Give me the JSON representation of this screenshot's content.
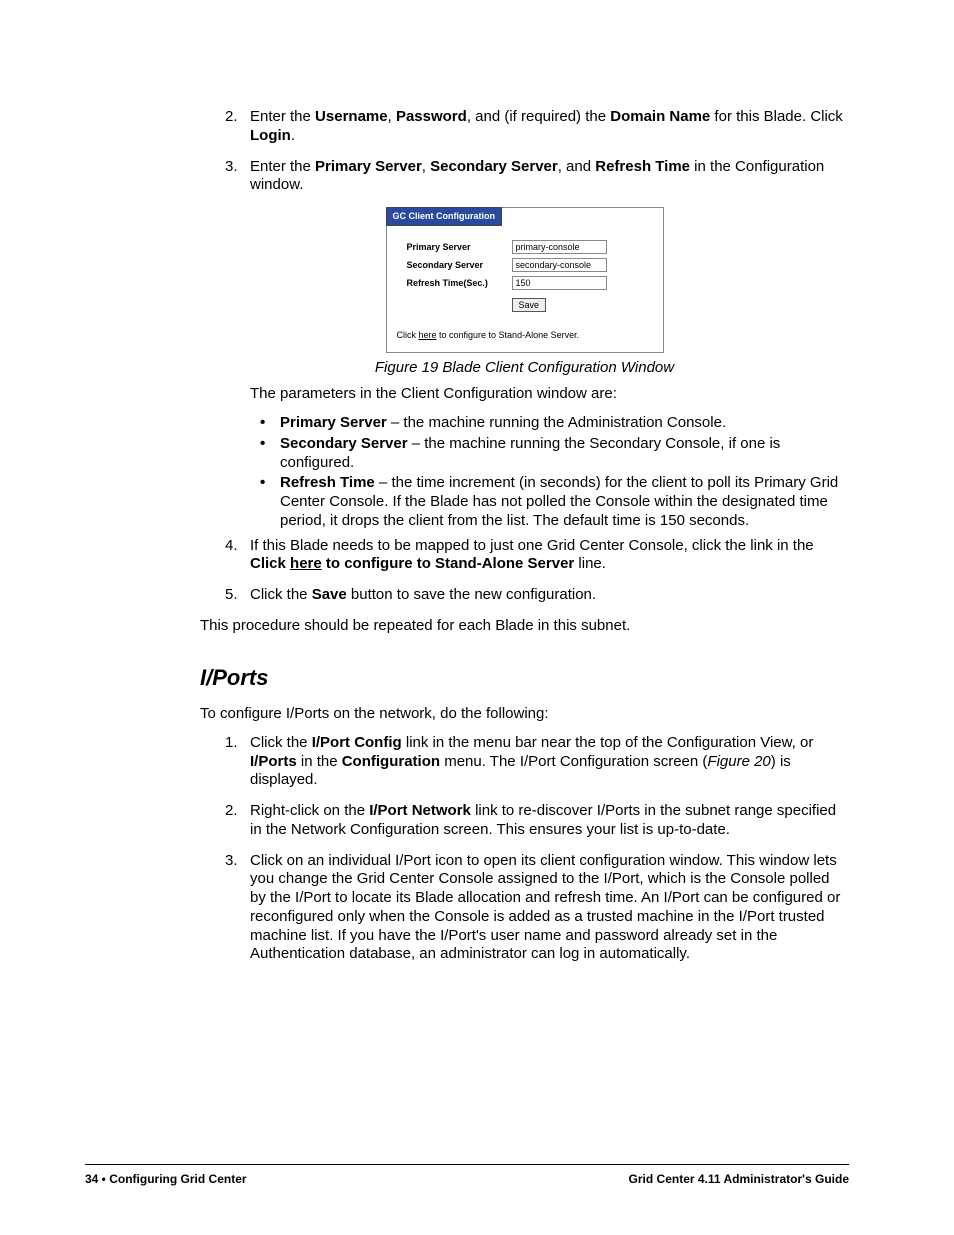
{
  "step2": {
    "num": "2.",
    "t1": "Enter the ",
    "b1": "Username",
    "t2": ", ",
    "b2": "Password",
    "t3": ", and (if required) the ",
    "b3": "Domain Name",
    "t4": " for this Blade. Click ",
    "b4": "Login",
    "t5": "."
  },
  "step3": {
    "num": "3.",
    "t1": "Enter the ",
    "b1": "Primary Server",
    "t2": ", ",
    "b2": "Secondary Server",
    "t3": ", and ",
    "b3": "Refresh Time",
    "t4": " in the Configuration window."
  },
  "figure": {
    "tab": "GC Client Configuration",
    "primary_label": "Primary Server",
    "primary_val": "primary-console",
    "secondary_label": "Secondary Server",
    "secondary_val": "secondary-console",
    "refresh_label": "Refresh Time(Sec.)",
    "refresh_val": "150",
    "save": "Save",
    "foot1": "Click ",
    "foot_link": "here",
    "foot2": " to configure to Stand-Alone Server.",
    "caption": "Figure 19  Blade Client Configuration Window"
  },
  "params_intro": "The parameters in the Client Configuration window are:",
  "bullet1": {
    "b": "Primary Server",
    "t": " – the machine running the Administration Console."
  },
  "bullet2": {
    "b": "Secondary Server",
    "t": " – the machine running the Secondary Console, if one is configured."
  },
  "bullet3": {
    "b": "Refresh Time",
    "t": " – the time increment (in seconds) for the client to poll its Primary Grid Center Console. If the Blade has not polled the Console within the designated time period, it drops the client from the list. The default time is 150 seconds."
  },
  "step4": {
    "num": "4.",
    "t1": "If this Blade needs to be mapped to just one Grid Center Console, click the link in the ",
    "b1": "Click ",
    "u1": "here",
    "b2": " to configure to Stand-Alone Server",
    "t2": " line."
  },
  "step5": {
    "num": "5.",
    "t1": "Click the ",
    "b1": "Save",
    "t2": " button to save the new configuration."
  },
  "closing": "This procedure should be repeated for each Blade in this subnet.",
  "heading": "I/Ports",
  "iports_intro": "To configure I/Ports on the network, do the following:",
  "ip1": {
    "num": "1.",
    "t1": "Click the ",
    "b1": "I/Port Config",
    "t2": " link in the menu bar near the top of the Configuration View, or ",
    "b2": "I/Ports",
    "t3": " in the ",
    "b3": "Configuration",
    "t4": " menu. The I/Port Configuration screen (",
    "i1": "Figure 20",
    "t5": ") is displayed."
  },
  "ip2": {
    "num": "2.",
    "t1": "Right-click on the ",
    "b1": "I/Port Network",
    "t2": " link to re-discover I/Ports in the subnet range specified in the Network Configuration screen. This ensures your list is up-to-date."
  },
  "ip3": {
    "num": "3.",
    "t1": "Click on an individual I/Port icon to open its client configuration window. This window lets you change the Grid Center Console assigned to the I/Port, which is the Console polled by the I/Port to locate its Blade allocation and refresh time. An I/Port can be configured or reconfigured only when the Console is added as a trusted machine in the I/Port trusted machine list. If you have the I/Port's user name and password already set in the Authentication database, an administrator can log in automatically."
  },
  "footer": {
    "left": "34 • Configuring Grid Center",
    "right": "Grid Center 4.11 Administrator's Guide"
  }
}
